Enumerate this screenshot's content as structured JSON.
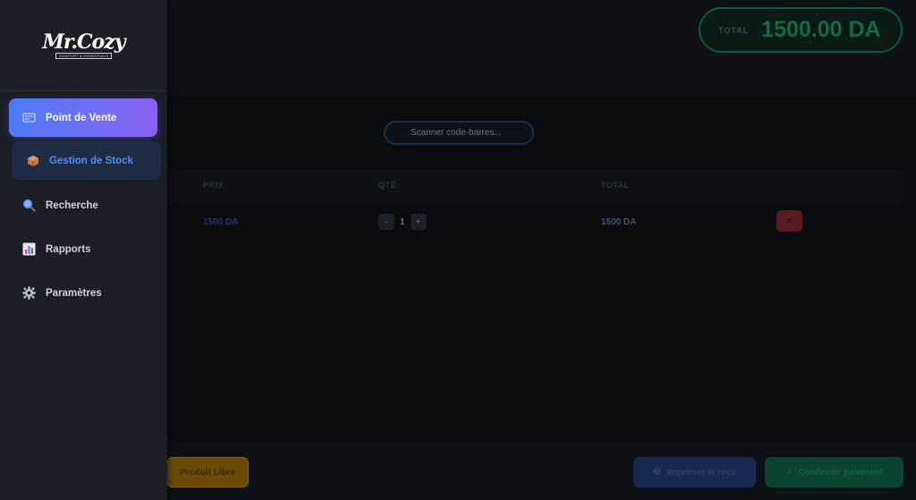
{
  "sidebar": {
    "logo": {
      "main": "Mr.Cozy",
      "sub": "CONFORT & ESSENTIALS"
    },
    "items": [
      {
        "label": "Point de Vente",
        "icon": "register-icon",
        "state": "active"
      },
      {
        "label": "Gestion de Stock",
        "icon": "box-icon",
        "state": "hover"
      },
      {
        "label": "Recherche",
        "icon": "magnifier-icon",
        "state": "normal"
      },
      {
        "label": "Rapports",
        "icon": "bar-chart-icon",
        "state": "normal"
      },
      {
        "label": "Paramètres",
        "icon": "gear-icon",
        "state": "normal"
      }
    ]
  },
  "header": {
    "total_label": "TOTAL",
    "total_value": "1500.00 DA"
  },
  "scanner": {
    "placeholder": "Scanner code-barres..."
  },
  "table": {
    "columns": [
      "PRIX",
      "QTÉ",
      "TOTAL"
    ],
    "rows": [
      {
        "price": "1500 DA",
        "qty": "1",
        "total": "1500 DA"
      }
    ],
    "minus": "-",
    "plus": "+",
    "delete": "✕"
  },
  "footer": {
    "libre": "Produit Libre",
    "print": "Imprimer le reçu",
    "confirm": "Confirmer paiement"
  },
  "colors": {
    "accent_start": "#4d7cf6",
    "accent_end": "#8b61f2",
    "total_green": "#22c57a",
    "hover_blue": "#4f8ef5"
  }
}
